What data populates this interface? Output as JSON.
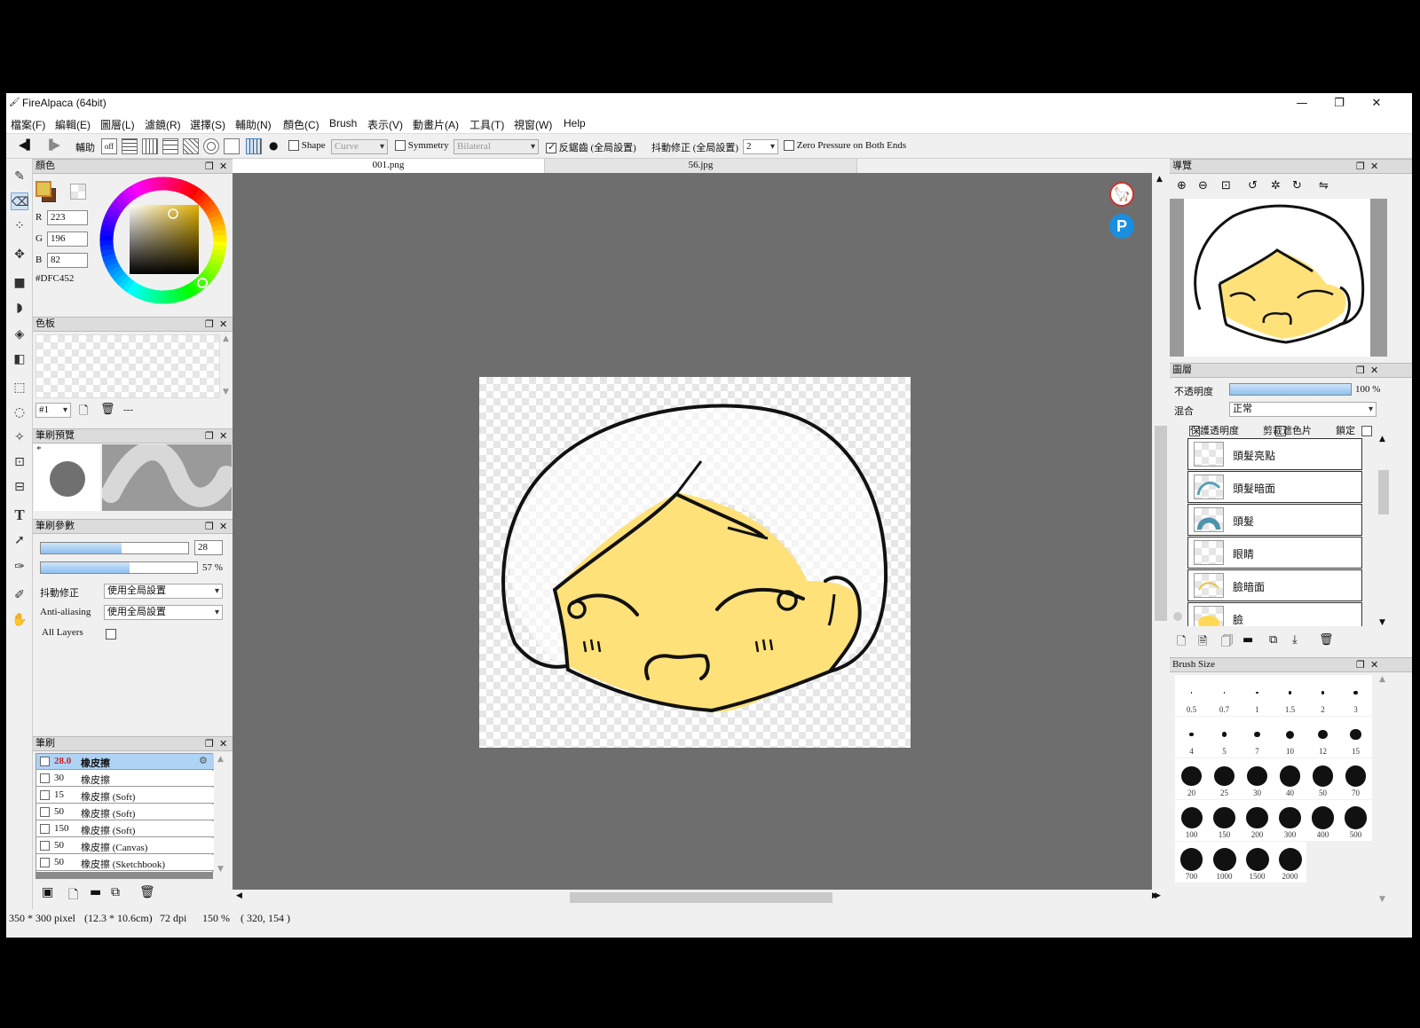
{
  "app": {
    "title": "FireAlpaca (64bit)"
  },
  "window": {
    "minimize": "—",
    "restore": "❐",
    "close": "✕"
  },
  "menu": [
    "檔案(F)",
    "編輯(E)",
    "圖層(L)",
    "濾鏡(R)",
    "選擇(S)",
    "輔助(N)",
    "顏色(C)",
    "Brush",
    "表示(V)",
    "動畫片(A)",
    "工具(T)",
    "視窗(W)",
    "Help"
  ],
  "toolbar": {
    "snap_label": "輔助",
    "snap_off": "off",
    "shape_label": "Shape",
    "shape_value": "Curve",
    "symmetry_label": "Symmetry",
    "symmetry_value": "Bilateral",
    "antialias_label": "反鋸齒 (全局設置)",
    "stabilizer_label": "抖動修正 (全局設置)",
    "stabilizer_value": "2",
    "zero_pressure_label": "Zero Pressure on Both Ends"
  },
  "color_panel": {
    "title": "顏色",
    "r_label": "R",
    "r": "223",
    "g_label": "G",
    "g": "196",
    "b_label": "B",
    "b": "82",
    "hex": "#DFC452",
    "primary_color": "#DFC452"
  },
  "palette_panel": {
    "title": "色板",
    "selector": "#1",
    "more": "---"
  },
  "brush_preview_panel": {
    "title": "筆刷預覽",
    "marker": "*"
  },
  "brush_params_panel": {
    "title": "筆刷參數",
    "size_value": "28",
    "size_fraction": 0.55,
    "opacity_value": "57 %",
    "opacity_fraction": 0.57,
    "stabilizer_label": "抖動修正",
    "stabilizer_value": "使用全局設置",
    "antialias_label": "Anti-aliasing",
    "antialias_value": "使用全局設置",
    "all_layers_label": "All Layers"
  },
  "brush_panel": {
    "title": "筆刷",
    "rows": [
      {
        "size": "28.0",
        "name": "橡皮擦",
        "selected": true
      },
      {
        "size": "30",
        "name": "橡皮擦"
      },
      {
        "size": "15",
        "name": "橡皮擦 (Soft)"
      },
      {
        "size": "50",
        "name": "橡皮擦 (Soft)"
      },
      {
        "size": "150",
        "name": "橡皮擦 (Soft)"
      },
      {
        "size": "50",
        "name": "橡皮擦 (Canvas)"
      },
      {
        "size": "50",
        "name": "橡皮擦 (Sketchbook)"
      }
    ]
  },
  "tabs": [
    "001.png",
    "56.jpg"
  ],
  "status": {
    "dimensions": "350 * 300 pixel",
    "physical": "(12.3 * 10.6cm)",
    "dpi": "72 dpi",
    "zoom": "150 %",
    "cursor": "( 320, 154 )"
  },
  "navigator_panel": {
    "title": "導覽"
  },
  "layer_panel": {
    "title": "圖層",
    "opacity_label": "不透明度",
    "opacity_value": "100 %",
    "opacity_fraction": 1.0,
    "blend_label": "混合",
    "blend_value": "正常",
    "protect_alpha": "保護透明度",
    "clipping": "剪裁遮色片",
    "lock": "鎖定",
    "layers": [
      "頭髮亮點",
      "頭髮暗面",
      "頭髮",
      "眼睛",
      "臉暗面",
      "臉"
    ]
  },
  "brush_size_panel": {
    "title": "Brush Size",
    "sizes": [
      "0.5",
      "0.7",
      "1",
      "1.5",
      "2",
      "3",
      "4",
      "5",
      "7",
      "10",
      "12",
      "15",
      "20",
      "25",
      "30",
      "40",
      "50",
      "70",
      "100",
      "150",
      "200",
      "300",
      "400",
      "500",
      "700",
      "1000",
      "1500",
      "2000"
    ]
  }
}
